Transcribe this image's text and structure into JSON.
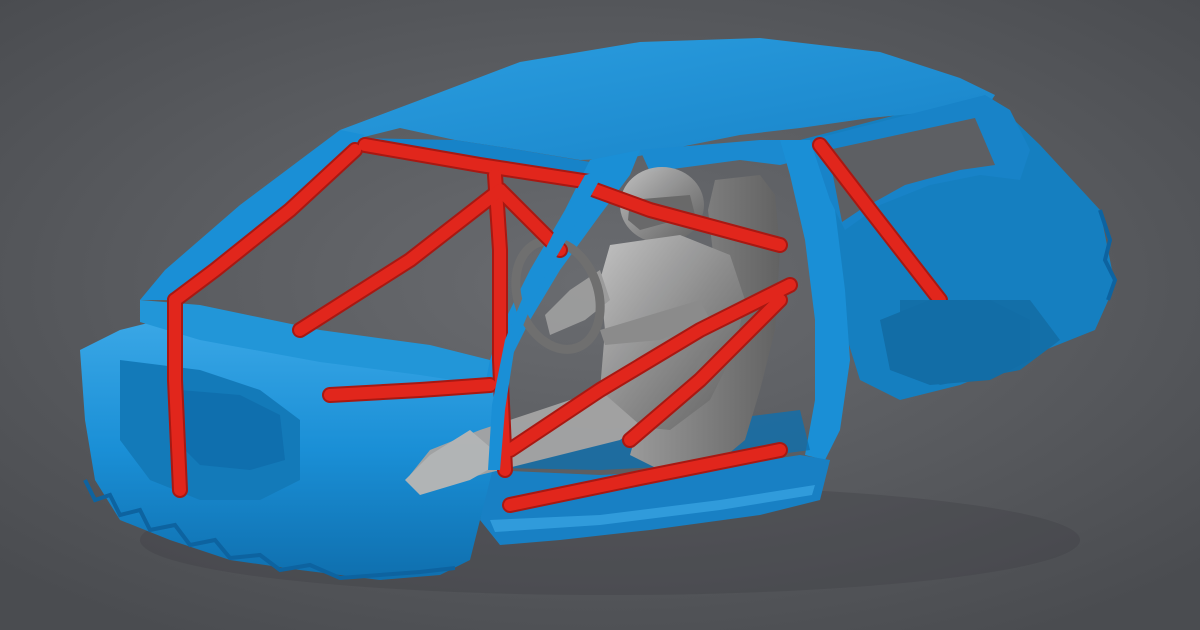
{
  "scene": {
    "subject": "car-body-shell-with-roll-cage-and-driver-3d-scan",
    "background_color": "#5c5e62",
    "colors": {
      "body_shell": "#1a8fd6",
      "body_shell_shadow": "#0f6fae",
      "body_shell_highlight": "#3aa7e6",
      "roll_cage": "#e1261c",
      "roll_cage_shadow": "#a81812",
      "driver_scan": "#8a8a8a",
      "driver_scan_light": "#b5b5b5",
      "seat": "#7c7c7c"
    }
  }
}
